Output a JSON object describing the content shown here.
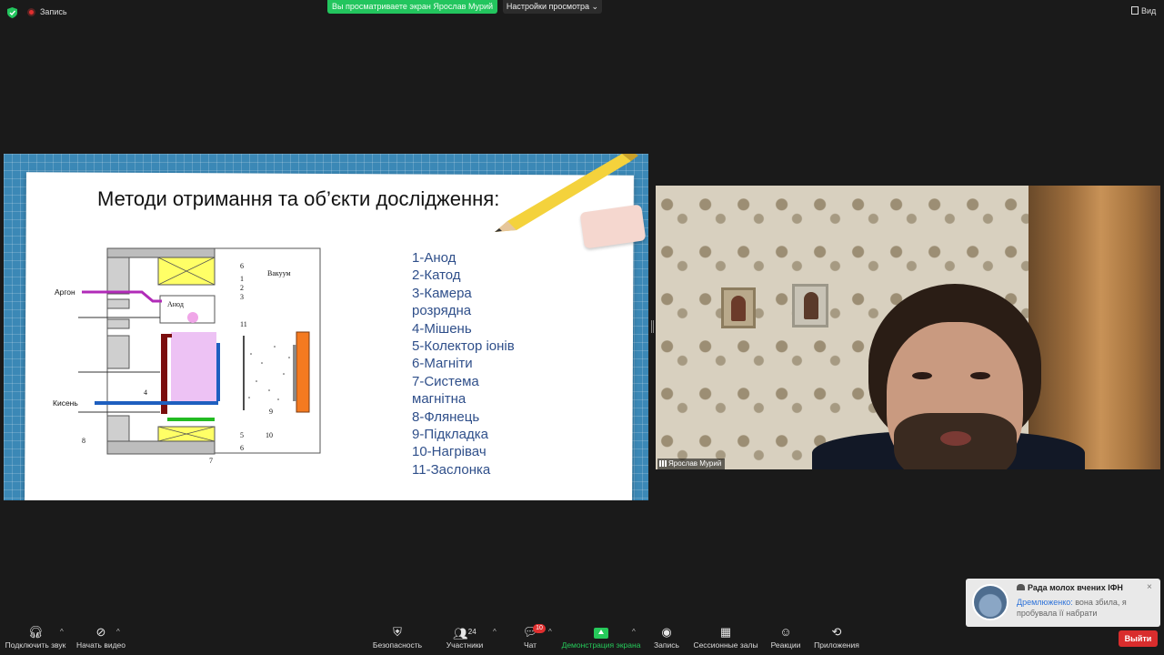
{
  "top_bar": {
    "recording_label": "Запись",
    "share_banner": "Вы просматриваете экран Ярослав Мурий",
    "view_settings_label": "Настройки просмотра",
    "view_label": "Вид"
  },
  "slide": {
    "title": "Методи отримання та об’єкти дослідження:",
    "legend": [
      "1-Анод",
      "2-Катод",
      "3-Камера",
      "розрядна",
      "4-Мішень",
      "5-Колектор іонів",
      "6-Магніти",
      "7-Система",
      "магнітна",
      "8-Флянець",
      "9-Підкладка",
      "10-Нагрівач",
      "11-Заслонка"
    ],
    "diagram": {
      "vacuum": "Вакуум",
      "argon": "Аргон",
      "oxygen": "Кисень",
      "anode": "Анод",
      "numbers": [
        "6",
        "1",
        "2",
        "3",
        "11",
        "4",
        "5",
        "6",
        "7",
        "8",
        "9",
        "10"
      ]
    }
  },
  "video": {
    "participant_name": "Ярослав Мурий"
  },
  "chat_toast": {
    "group": "Рада молох вчених ІФН",
    "sender": "Дремлюженко:",
    "message": " вона збила, я пробувала її набрати",
    "close": "×"
  },
  "toolbar": {
    "audio": "Подключить звук",
    "video": "Начать видео",
    "security": "Безопасность",
    "participants": "Участники",
    "participants_count": "24",
    "chat": "Чат",
    "chat_badge": "10",
    "share": "Демонстрация экрана",
    "record": "Запись",
    "breakout": "Сессионные залы",
    "reactions": "Реакции",
    "apps": "Приложения",
    "leave": "Выйти"
  },
  "colors": {
    "share_green": "#23c55e",
    "leave_red": "#d92d2d",
    "slide_text_blue": "#2f4f8a",
    "sender_blue": "#2d72d9"
  }
}
